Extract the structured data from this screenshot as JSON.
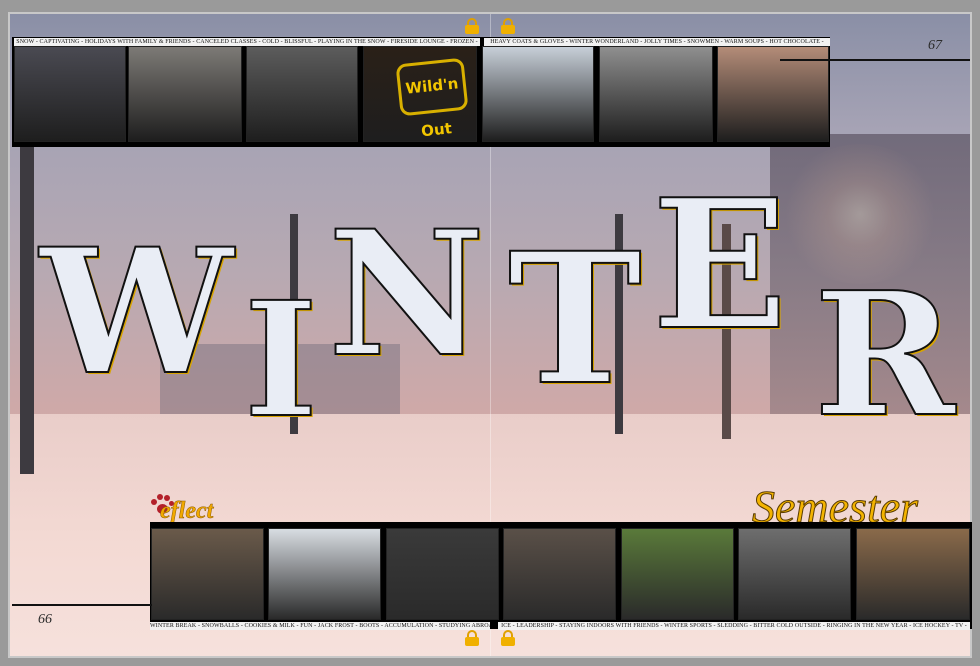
{
  "spread": {
    "title": [
      "W",
      "I",
      "N",
      "T",
      "E",
      "R"
    ],
    "subtitle_left": "eflect",
    "subtitle_right": "Semester",
    "page_left": "66",
    "page_right": "67"
  },
  "captions": {
    "top_left": "SNOW - CAPTIVATING - HOLIDAYS WITH FAMILY & FRIENDS - CANCELED CLASSES - COLD - BLISSFUL - PLAYING IN THE SNOW - FIRESIDE LOUNGE - FROZEN -",
    "top_right": "HEAVY COATS & GLOVES - WINTER WONDERLAND - JOLLY TIMES - SNOWMEN - WARM SOUPS - HOT CHOCOLATE -",
    "bottom_left": "WINTER BREAK - SNOWBALLS - COOKIES & MILK - FUN - JACK FROST - BOOTS - ACCUMULATION - STUDYING ABROAD -",
    "bottom_right": "ICE - LEADERSHIP - STAYING INDOORS WITH FRIENDS - WINTER SPORTS - SLEDDING - BITTER COLD OUTSIDE - RINGING IN THE NEW YEAR - ICE HOCKEY - TV -"
  },
  "photos_top": [
    {
      "name": "group-photo-students",
      "color": "#4a4a52"
    },
    {
      "name": "group-photo-tshirts",
      "color": "#7d7a76"
    },
    {
      "name": "wrestling-match-photo",
      "color": "#5c5c5c"
    },
    {
      "name": "wild-n-out-stage-photo",
      "color": "#2a2018",
      "text": "Wild'n Out"
    },
    {
      "name": "snow-lying-photo",
      "color": "#c7cfd8"
    },
    {
      "name": "javelin-throw-photo",
      "color": "#8f8f8f"
    },
    {
      "name": "snowy-bench-night-photo",
      "color": "#b48c78"
    }
  ],
  "photos_bottom": [
    {
      "name": "mascot-with-staff-photo",
      "color": "#6a5a4a"
    },
    {
      "name": "snowball-fight-photo",
      "color": "#d8dde2"
    },
    {
      "name": "basketball-game-photo",
      "color": "#3a3a3a"
    },
    {
      "name": "cafeteria-group-photo",
      "color": "#5a5048"
    },
    {
      "name": "shot-put-athlete-photo",
      "color": "#5a7a3a"
    },
    {
      "name": "cheer-team-photo",
      "color": "#6e6e6e"
    },
    {
      "name": "mascot-with-children-photo",
      "color": "#8a6a4a"
    }
  ],
  "colors": {
    "accent_gold": "#f4b400",
    "caption_bg": "#f2f2f2",
    "strip_black": "#000000"
  }
}
